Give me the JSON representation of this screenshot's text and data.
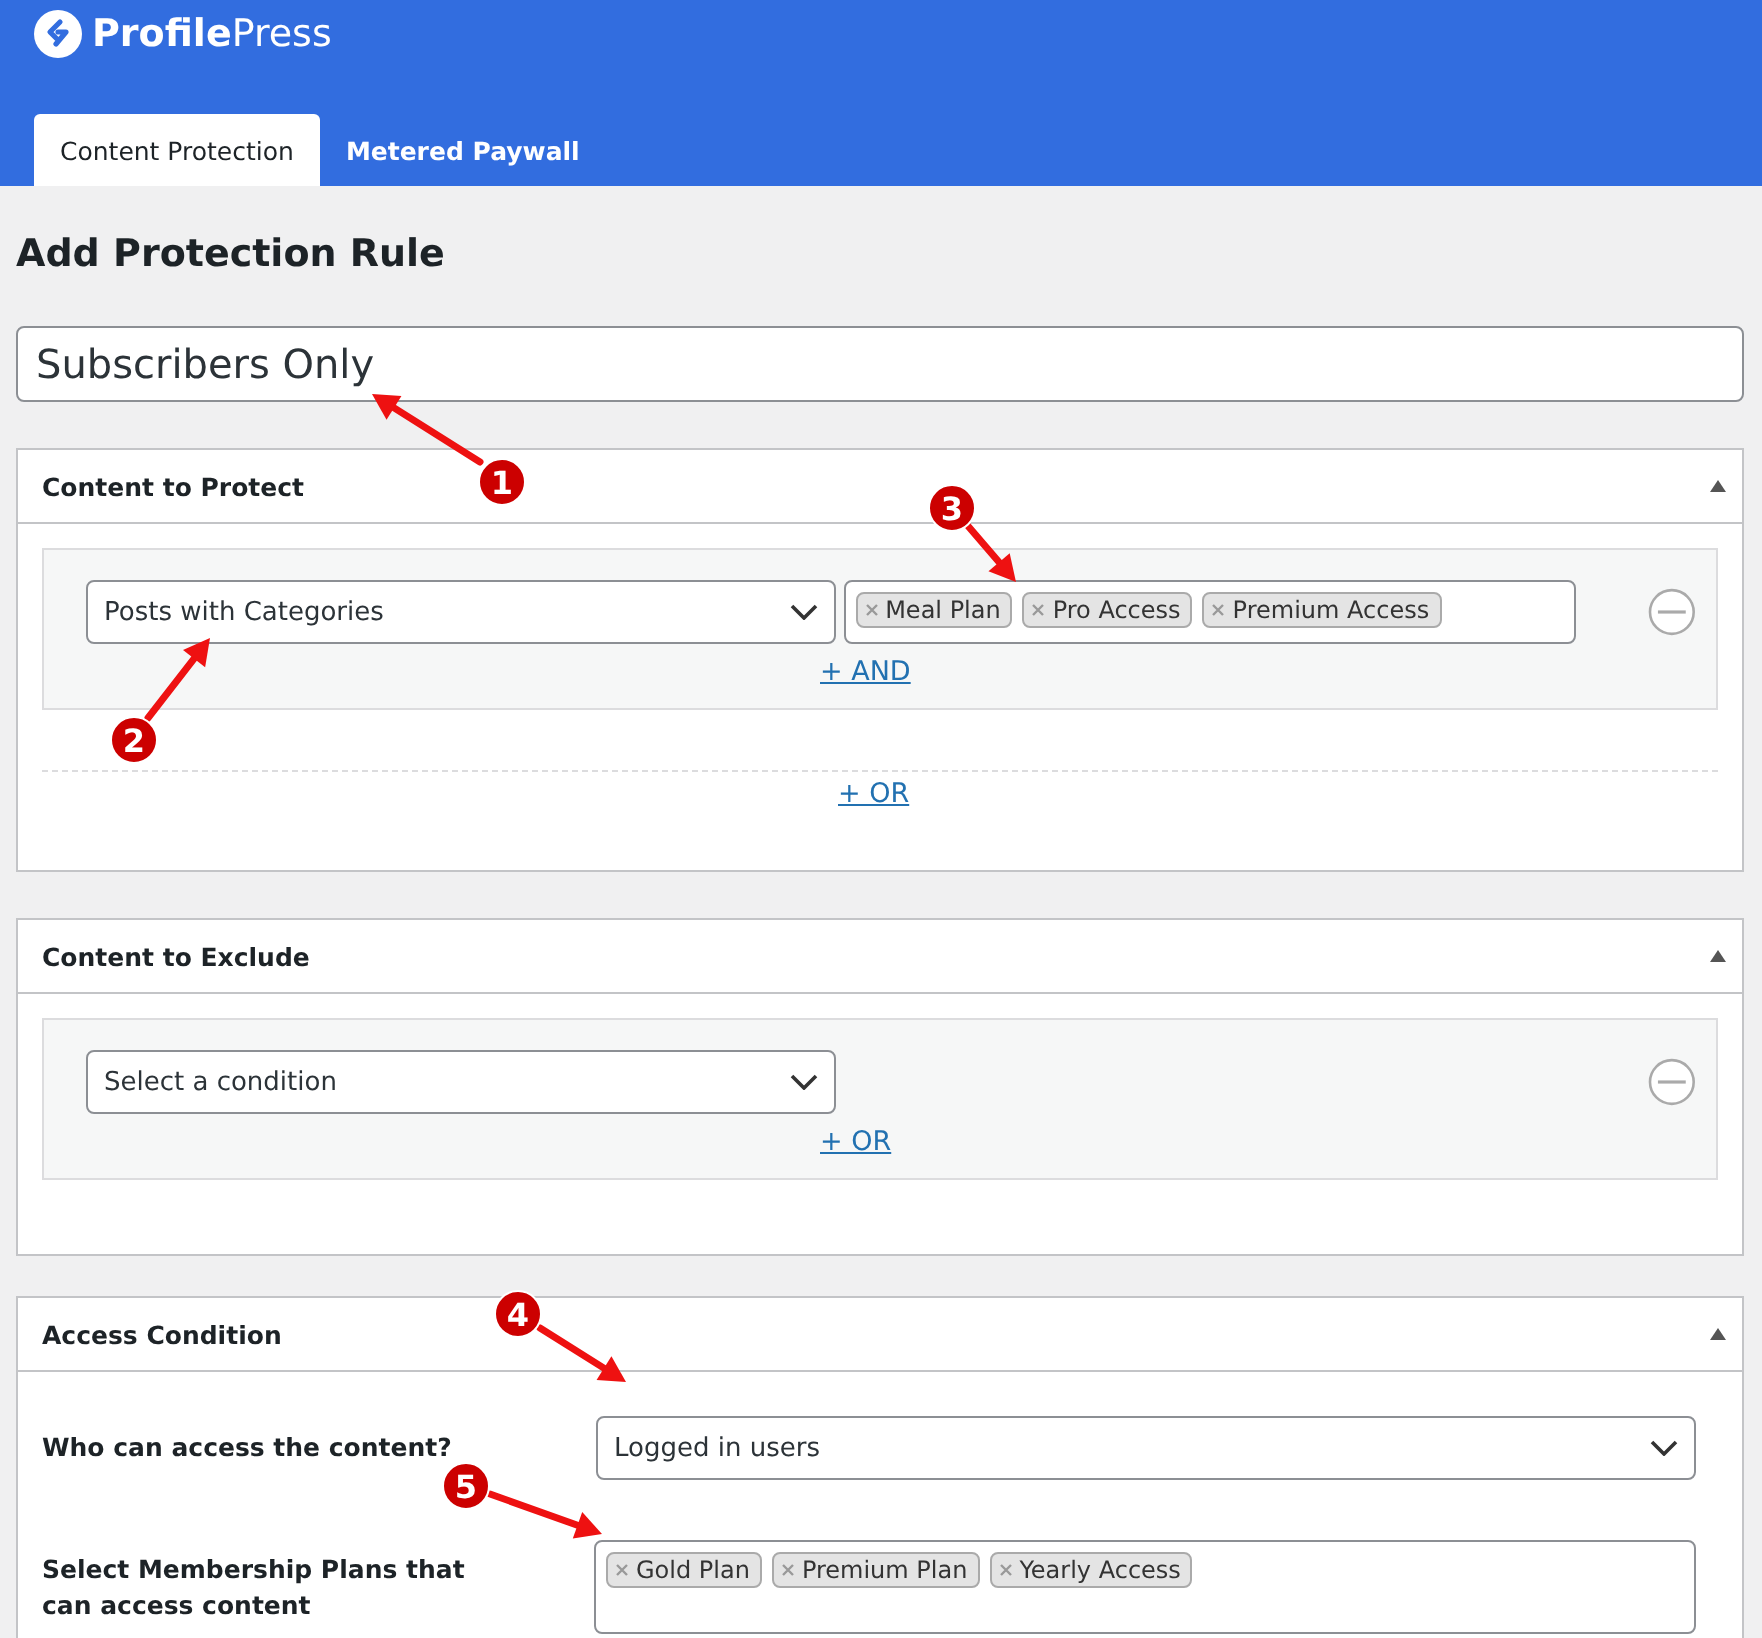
{
  "brand": {
    "name_bold": "Profile",
    "name_light": "Press"
  },
  "tabs": [
    {
      "label": "Content Protection",
      "selected": true
    },
    {
      "label": "Metered Paywall",
      "selected": false
    }
  ],
  "page_title": "Add Protection Rule",
  "rule_title": {
    "value": "Subscribers Only"
  },
  "protect_panel": {
    "title": "Content to Protect",
    "condition": "Posts with Categories",
    "tags": [
      "Meal Plan",
      "Pro Access",
      "Premium Access"
    ],
    "and_link": "+ AND",
    "or_link": "+ OR"
  },
  "exclude_panel": {
    "title": "Content to Exclude",
    "condition": "Select a condition",
    "or_link": "+ OR"
  },
  "access_panel": {
    "title": "Access Condition",
    "who_label": "Who can access the content?",
    "who_value": "Logged in users",
    "plans_label": "Select Membership Plans that can access content",
    "plans": [
      "Gold Plan",
      "Premium Plan",
      "Yearly Access"
    ]
  },
  "annotations": [
    {
      "label": "1"
    },
    {
      "label": "2"
    },
    {
      "label": "3"
    },
    {
      "label": "4"
    },
    {
      "label": "5"
    }
  ]
}
